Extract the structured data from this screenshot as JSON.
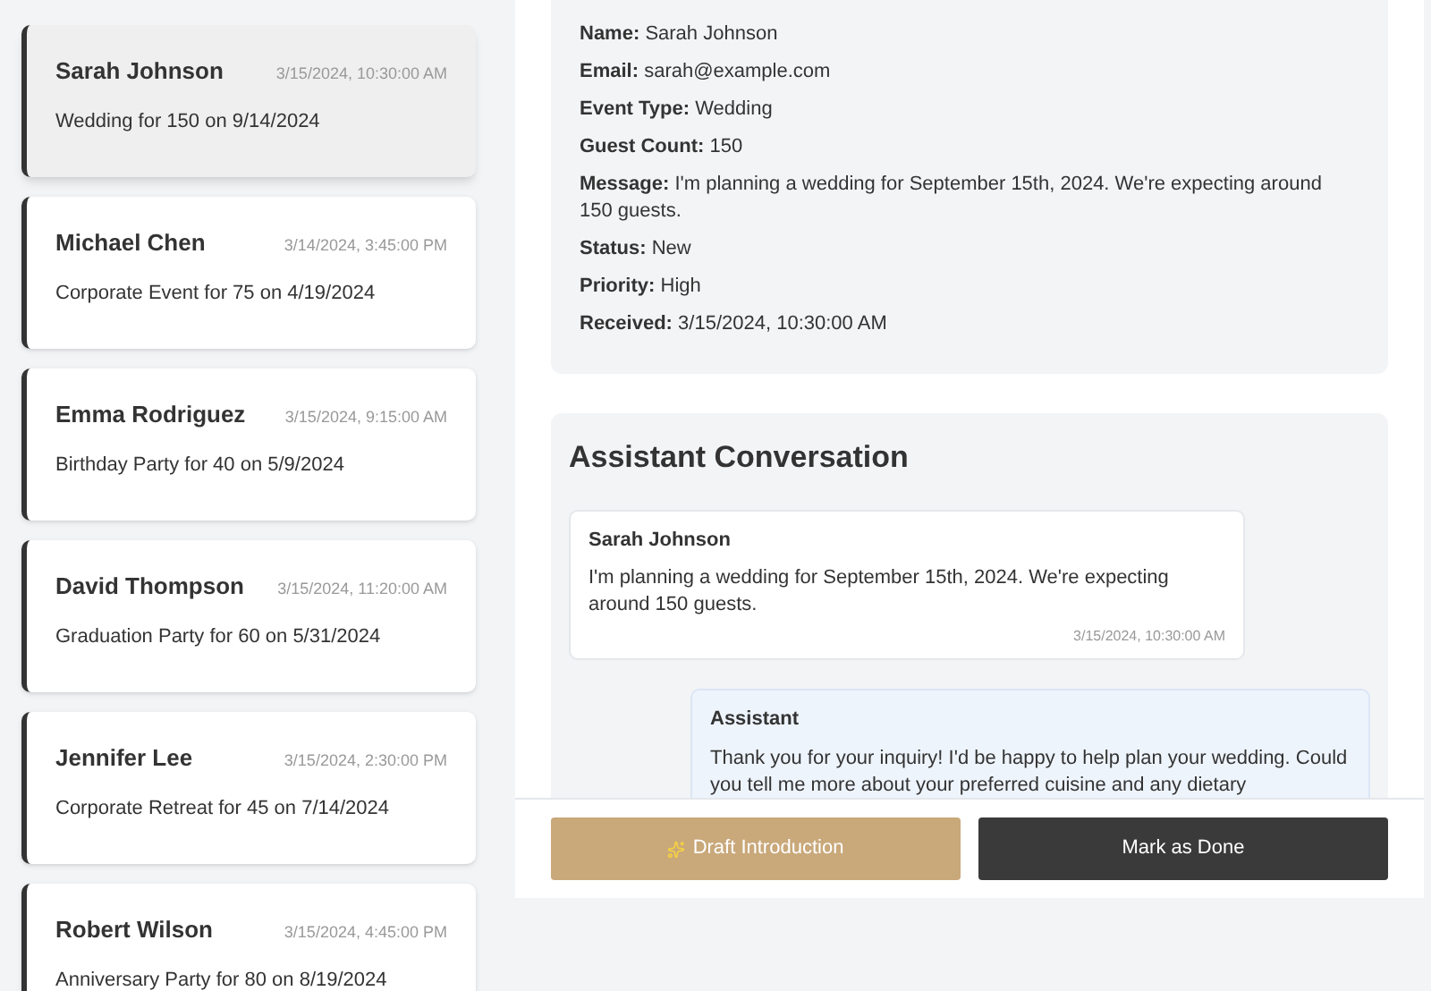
{
  "inquiries": [
    {
      "name": "Sarah Johnson",
      "date": "3/15/2024, 10:30:00 AM",
      "summary": "Wedding for 150 on 9/14/2024",
      "selected": true
    },
    {
      "name": "Michael Chen",
      "date": "3/14/2024, 3:45:00 PM",
      "summary": "Corporate Event for 75 on 4/19/2024",
      "selected": false
    },
    {
      "name": "Emma Rodriguez",
      "date": "3/15/2024, 9:15:00 AM",
      "summary": "Birthday Party for 40 on 5/9/2024",
      "selected": false
    },
    {
      "name": "David Thompson",
      "date": "3/15/2024, 11:20:00 AM",
      "summary": "Graduation Party for 60 on 5/31/2024",
      "selected": false
    },
    {
      "name": "Jennifer Lee",
      "date": "3/15/2024, 2:30:00 PM",
      "summary": "Corporate Retreat for 45 on 7/14/2024",
      "selected": false
    },
    {
      "name": "Robert Wilson",
      "date": "3/15/2024, 4:45:00 PM",
      "summary": "Anniversary Party for 80 on 8/19/2024",
      "selected": false
    }
  ],
  "details": [
    {
      "label": "Name:",
      "value": "Sarah Johnson"
    },
    {
      "label": "Email:",
      "value": "sarah@example.com"
    },
    {
      "label": "Event Type:",
      "value": "Wedding"
    },
    {
      "label": "Guest Count:",
      "value": "150"
    },
    {
      "label": "Message:",
      "value": "I'm planning a wedding for September 15th, 2024. We're expecting around 150 guests."
    },
    {
      "label": "Status:",
      "value": "New"
    },
    {
      "label": "Priority:",
      "value": "High"
    },
    {
      "label": "Received:",
      "value": "3/15/2024, 10:30:00 AM"
    }
  ],
  "conversation": {
    "title": "Assistant Conversation",
    "messages": [
      {
        "kind": "user",
        "sender": "Sarah Johnson",
        "text": "I'm planning a wedding for September 15th, 2024. We're expecting around 150 guests.",
        "time": "3/15/2024, 10:30:00 AM"
      },
      {
        "kind": "assistant",
        "sender": "Assistant",
        "text": "Thank you for your inquiry! I'd be happy to help plan your wedding. Could you tell me more about your preferred cuisine and any dietary"
      }
    ]
  },
  "actions": [
    {
      "kind": "draft",
      "label": "Draft Introduction"
    },
    {
      "kind": "done",
      "label": "Mark as Done"
    }
  ]
}
